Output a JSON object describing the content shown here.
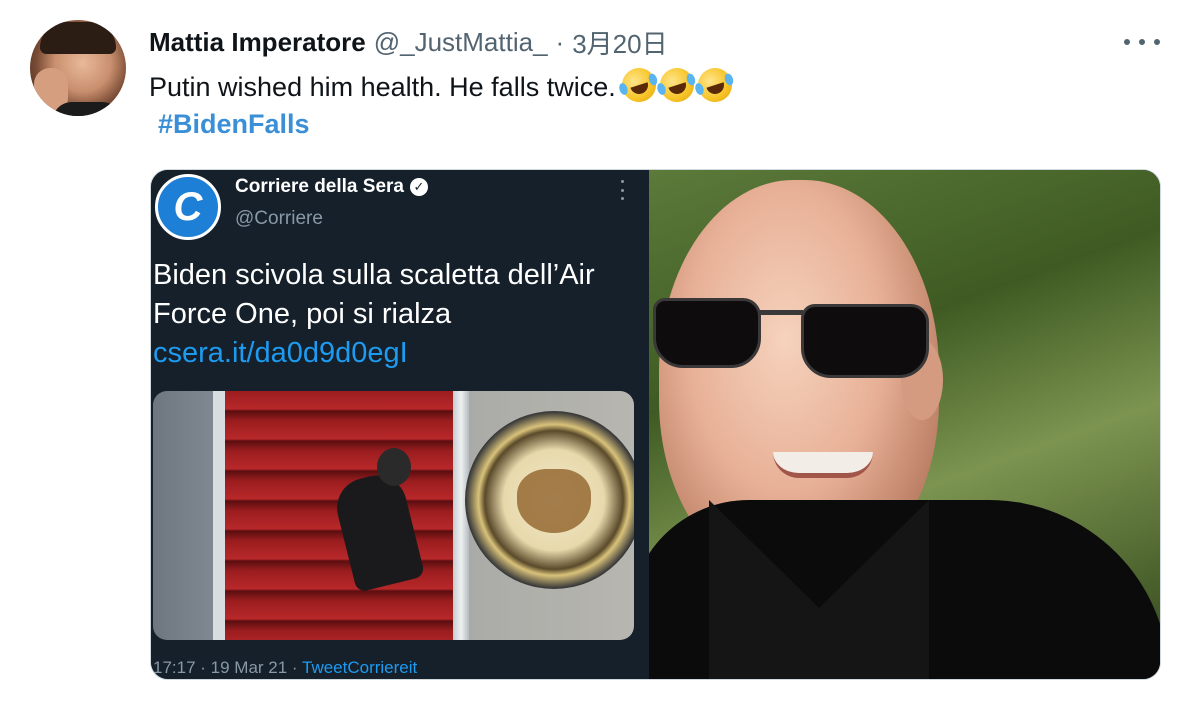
{
  "tweet": {
    "display_name": "Mattia Imperatore",
    "handle": "@_JustMattia_",
    "separator": "·",
    "date": "3月20日",
    "text": "Putin wished him health. He falls twice.",
    "emojis": [
      "rolling-on-the-floor-laughing",
      "rolling-on-the-floor-laughing",
      "rolling-on-the-floor-laughing"
    ],
    "hashtag": "#BidenFalls"
  },
  "embedded_tweet": {
    "logo_letter": "C",
    "source_name": "Corriere della Sera",
    "verified_mark": "✓",
    "source_handle": "@Corriere",
    "text": "Biden scivola sulla scaletta dell’Air Force One, poi si rialza",
    "link": "csera.it/da0d9d0egI",
    "footer_time": "17:17 · 19 Mar 21 · ",
    "footer_app": "TweetCorriereit"
  },
  "colors": {
    "text": "#0f1419",
    "secondary": "#536471",
    "hashtag": "#3a8fd6",
    "link": "#1d9bf0",
    "embedded_bg": "#15202b",
    "card_border": "#cfd9de"
  }
}
